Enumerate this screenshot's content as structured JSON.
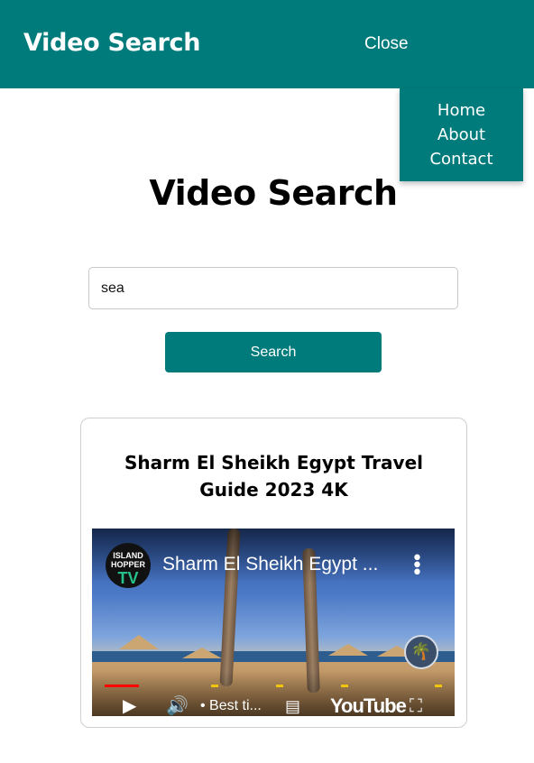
{
  "header": {
    "brand": "Video Search",
    "close_label": "Close"
  },
  "menu": {
    "items": [
      "Home",
      "About",
      "Contact"
    ]
  },
  "main": {
    "heading": "Video Search",
    "search": {
      "value": "sea",
      "placeholder": ""
    },
    "search_button_label": "Search"
  },
  "result": {
    "title": "Sharm El Sheikh Egypt Travel Guide 2023 4K",
    "video": {
      "overlay_title": "Sharm El Sheikh Egypt ...",
      "channel_logo_top": "ISLAND HOPPER",
      "channel_logo_bottom": "TV",
      "chapter_text": "• Best ti...",
      "brand_text": "YouTube"
    }
  },
  "colors": {
    "accent": "#007b7b",
    "progress_played": "#ff0000",
    "progress_chapter": "#f1c40f"
  },
  "icons": [
    "menu-dots-icon",
    "play-icon",
    "volume-icon",
    "subtitles-icon",
    "fullscreen-icon",
    "palm-badge-icon"
  ]
}
